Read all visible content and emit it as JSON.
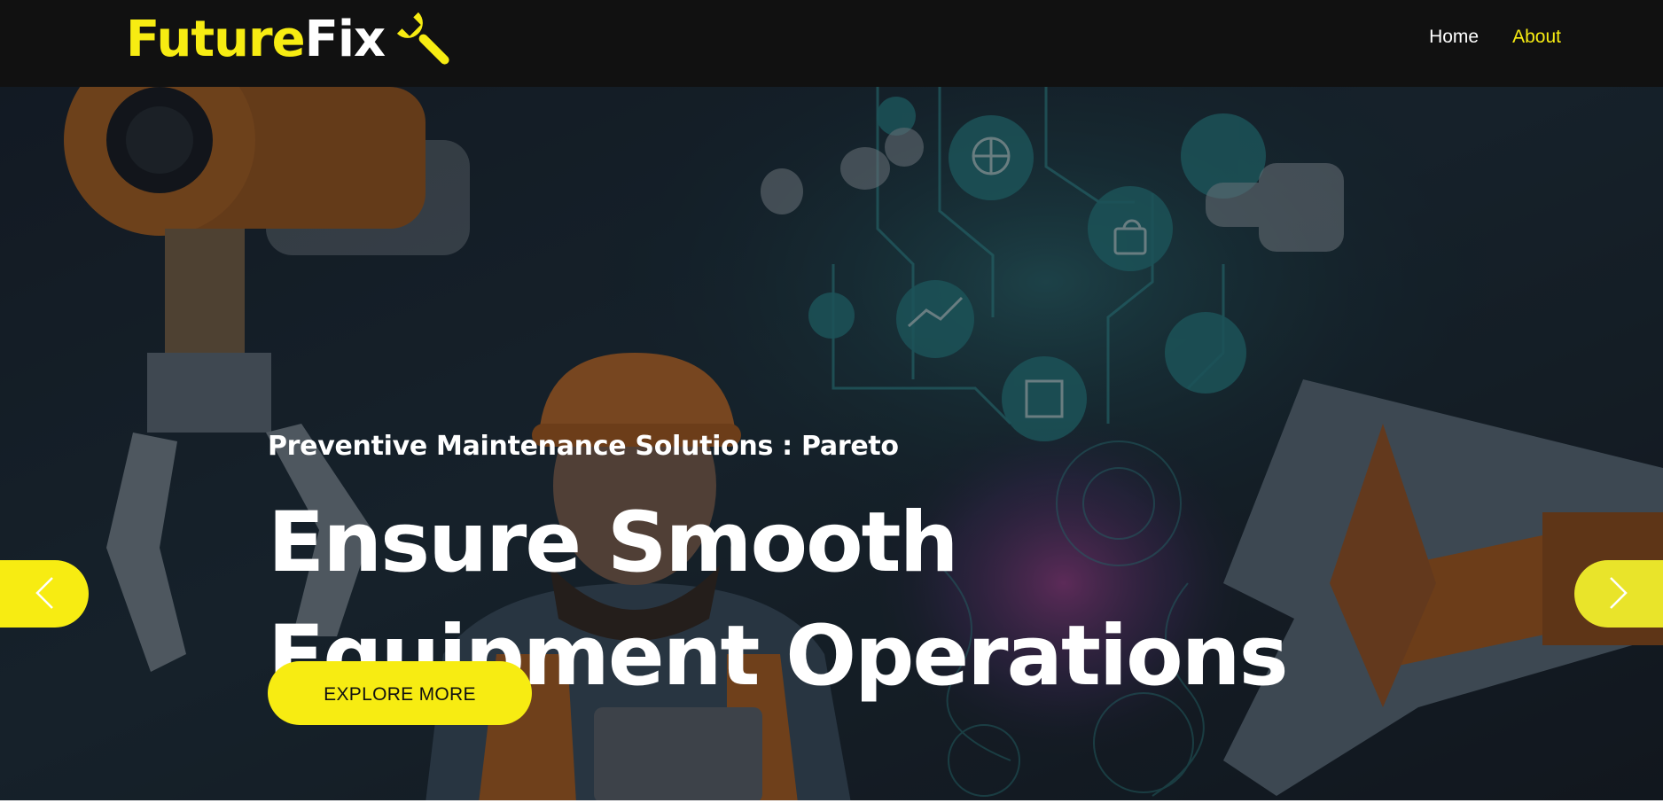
{
  "brand": {
    "name_part1": "Future",
    "name_part2": "Fix",
    "icon": "wrench-icon"
  },
  "nav": {
    "items": [
      {
        "label": "Home",
        "active": false
      },
      {
        "label": "About",
        "active": true
      }
    ]
  },
  "hero": {
    "subtitle": "Preventive Maintenance Solutions : Pareto",
    "headline_line1": "Ensure Smooth",
    "headline_line2": "Equipment Operations",
    "cta_label": "EXPLORE MORE",
    "prev_icon": "chevron-left-icon",
    "next_icon": "chevron-right-icon"
  },
  "colors": {
    "accent": "#f7ec12",
    "navbar_bg": "#111111",
    "text": "#ffffff"
  }
}
